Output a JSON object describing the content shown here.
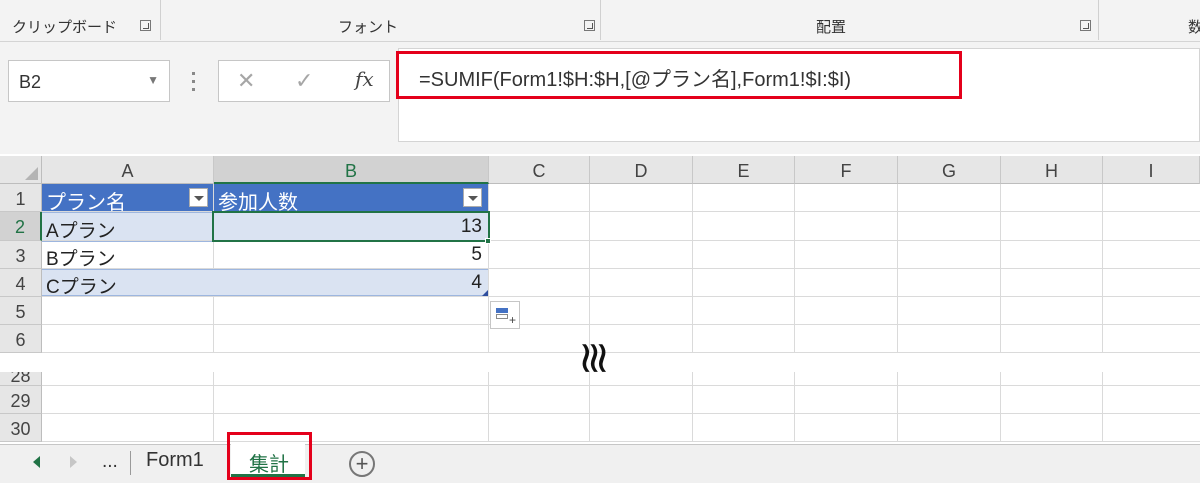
{
  "ribbon": {
    "groups": [
      "クリップボード",
      "フォント",
      "配置",
      "数"
    ]
  },
  "formula_bar": {
    "name_box": "B2",
    "cancel_icon": "✕",
    "enter_icon": "✓",
    "fx_label": "fx",
    "formula": "=SUMIF(Form1!$H:$H,[@プラン名],Form1!$I:$I)"
  },
  "sheet": {
    "columns": [
      "A",
      "B",
      "C",
      "D",
      "E",
      "F",
      "G",
      "H",
      "I"
    ],
    "selected_cell": "B2",
    "rows_top": [
      "1",
      "2",
      "3",
      "4",
      "5",
      "6"
    ],
    "rows_bottom": [
      "28",
      "29",
      "30"
    ],
    "table": {
      "headers": [
        "プラン名",
        "参加人数"
      ],
      "rows": [
        {
          "plan": "Aプラン",
          "count": "13"
        },
        {
          "plan": "Bプラン",
          "count": "5"
        },
        {
          "plan": "Cプラン",
          "count": "4"
        }
      ]
    },
    "break_symbol": "≋"
  },
  "tabs": {
    "ellipsis": "...",
    "items": [
      "Form1",
      "集計"
    ],
    "active": "集計",
    "add_icon": "+"
  },
  "colors": {
    "table_header": "#4472c4",
    "band": "#dae3f2",
    "selection": "#217346",
    "highlight_box": "#e4001b"
  }
}
